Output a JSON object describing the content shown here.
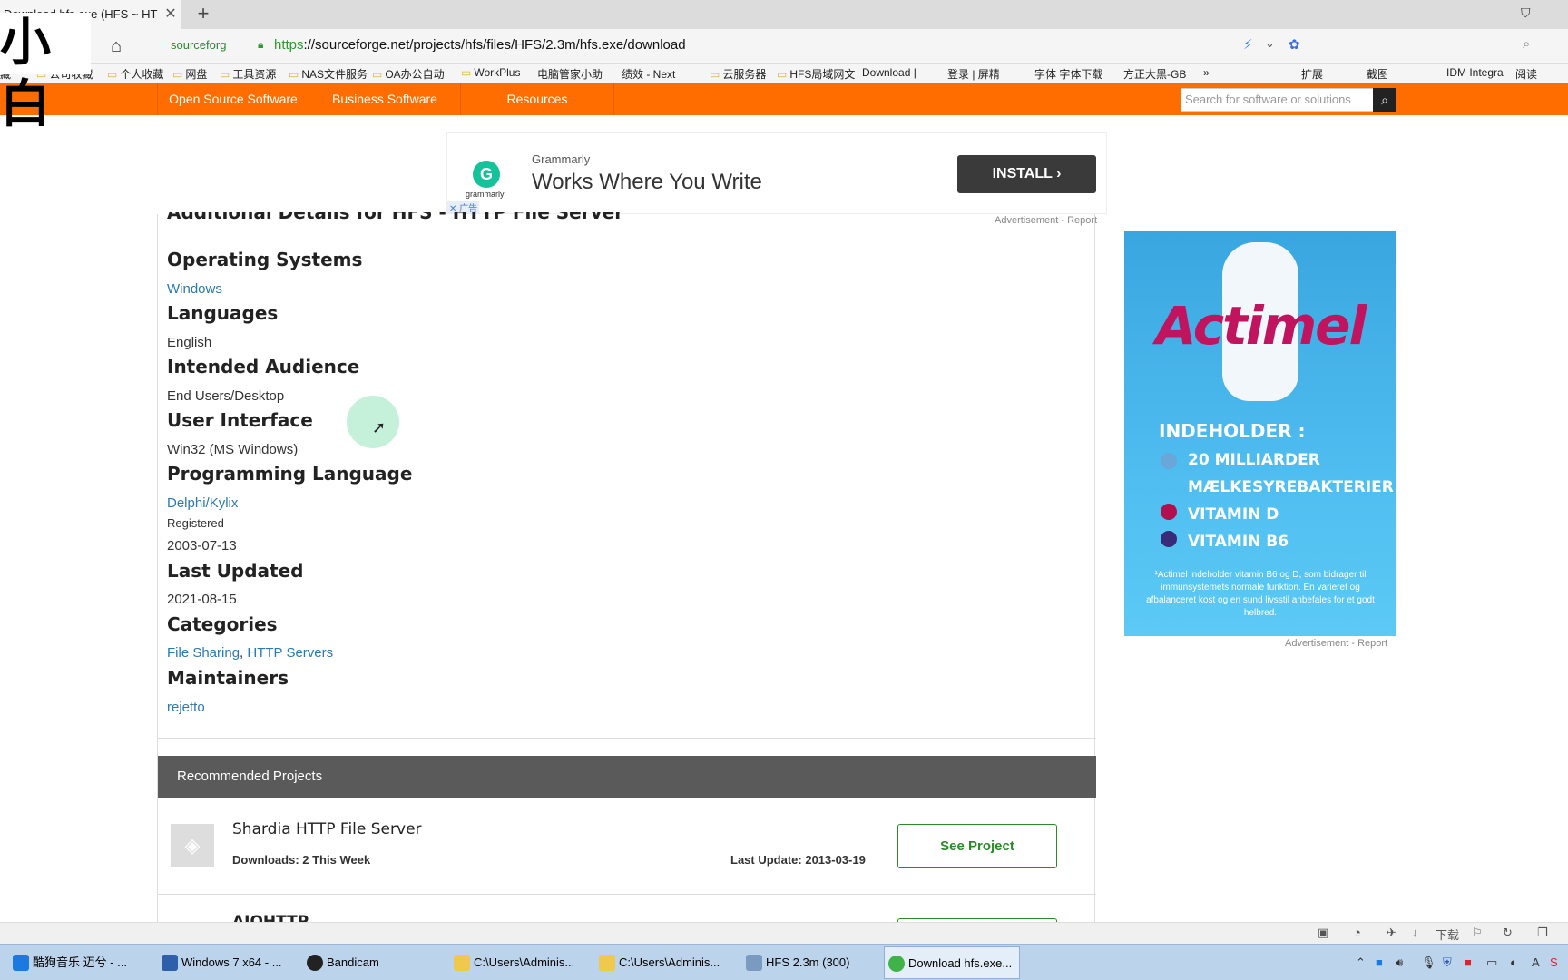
{
  "browser": {
    "tab_title": "Download hfs.exe (HFS ~ HT",
    "tab_close": "✕",
    "new_tab": "+",
    "site_badge": "sourceforg",
    "url_scheme": "https",
    "url_rest": "://sourceforge.net/projects/hfs/files/HFS/2.3m/hfs.exe/download",
    "overlay_logo": "小白",
    "bookmarks": [
      "藏",
      "公司收藏",
      "个人收藏",
      "网盘",
      "工具资源",
      "NAS文件服务",
      "OA办公自动",
      "WorkPlus",
      "电脑管家小助",
      "绩效 - Next",
      "云服务器",
      "HFS局域网文",
      "Download |",
      "登录 | 屏精",
      "字体 字体下载",
      "方正大黑-GB",
      "»",
      "扩展",
      "截图",
      "IDM Integra",
      "阅读"
    ]
  },
  "site_nav": {
    "items": [
      "Open Source Software",
      "Business Software",
      "Resources"
    ],
    "search_placeholder": "Search for software or solutions",
    "search_icon": "magnifier-icon"
  },
  "ad_top": {
    "brand": "Grammarly",
    "logo_text": "grammarly",
    "logo_letter": "G",
    "headline": "Works Where You Write",
    "button": "INSTALL  ›",
    "close_tag": "✕ 广告",
    "report": "Advertisement - Report"
  },
  "details": {
    "cut_heading": "Additional Details for HFS - HTTP File Server",
    "os_heading": "Operating Systems",
    "os_value": "Windows",
    "lang_heading": "Languages",
    "lang_value": "English",
    "audience_heading": "Intended Audience",
    "audience_value": "End Users/Desktop",
    "ui_heading": "User Interface",
    "ui_value": "Win32 (MS Windows)",
    "prog_heading": "Programming Language",
    "prog_value": "Delphi/Kylix",
    "registered_label": "Registered",
    "registered_value": "2003-07-13",
    "updated_heading": "Last Updated",
    "updated_value": "2021-08-15",
    "cat_heading": "Categories",
    "cat_1": "File Sharing",
    "cat_sep": ", ",
    "cat_2": "HTTP Servers",
    "maint_heading": "Maintainers",
    "maint_value": "rejetto"
  },
  "recommended": {
    "header": "Recommended Projects",
    "projects": [
      {
        "title": "Shardia HTTP File Server",
        "downloads": "Downloads: 2 This Week",
        "last_update": "Last Update: 2013-03-19",
        "button": "See Project"
      },
      {
        "title": "AIOHTTP"
      }
    ]
  },
  "ad_right": {
    "brand": "Actimel",
    "heading": "INDEHOLDER :",
    "items": [
      "20 MILLIARDER",
      "MÆLKESYREBAKTERIER",
      "VITAMIN D",
      "VITAMIN B6"
    ],
    "fine_print": "¹Actimel indeholder vitamin B6 og D, som bidrager til immunsystemets normale funktion. En varieret og afbalanceret kost og en sund livsstil anbefales for et godt helbred.",
    "report": "Advertisement - Report",
    "colors": {
      "brand": "#c0145e",
      "background": "#4fbdf0"
    }
  },
  "statusbar": {
    "download_label": "下载"
  },
  "taskbar": {
    "items": [
      "酷狗音乐 迈兮 - ...",
      "Windows 7 x64 - ...",
      "Bandicam",
      "C:\\Users\\Adminis...",
      "C:\\Users\\Adminis...",
      "HFS 2.3m (300)",
      "Download hfs.exe..."
    ]
  },
  "colors": {
    "sourceforge_orange": "#ff6d00",
    "link": "#2a7ab0",
    "see_project_green": "#2a8a2a"
  }
}
